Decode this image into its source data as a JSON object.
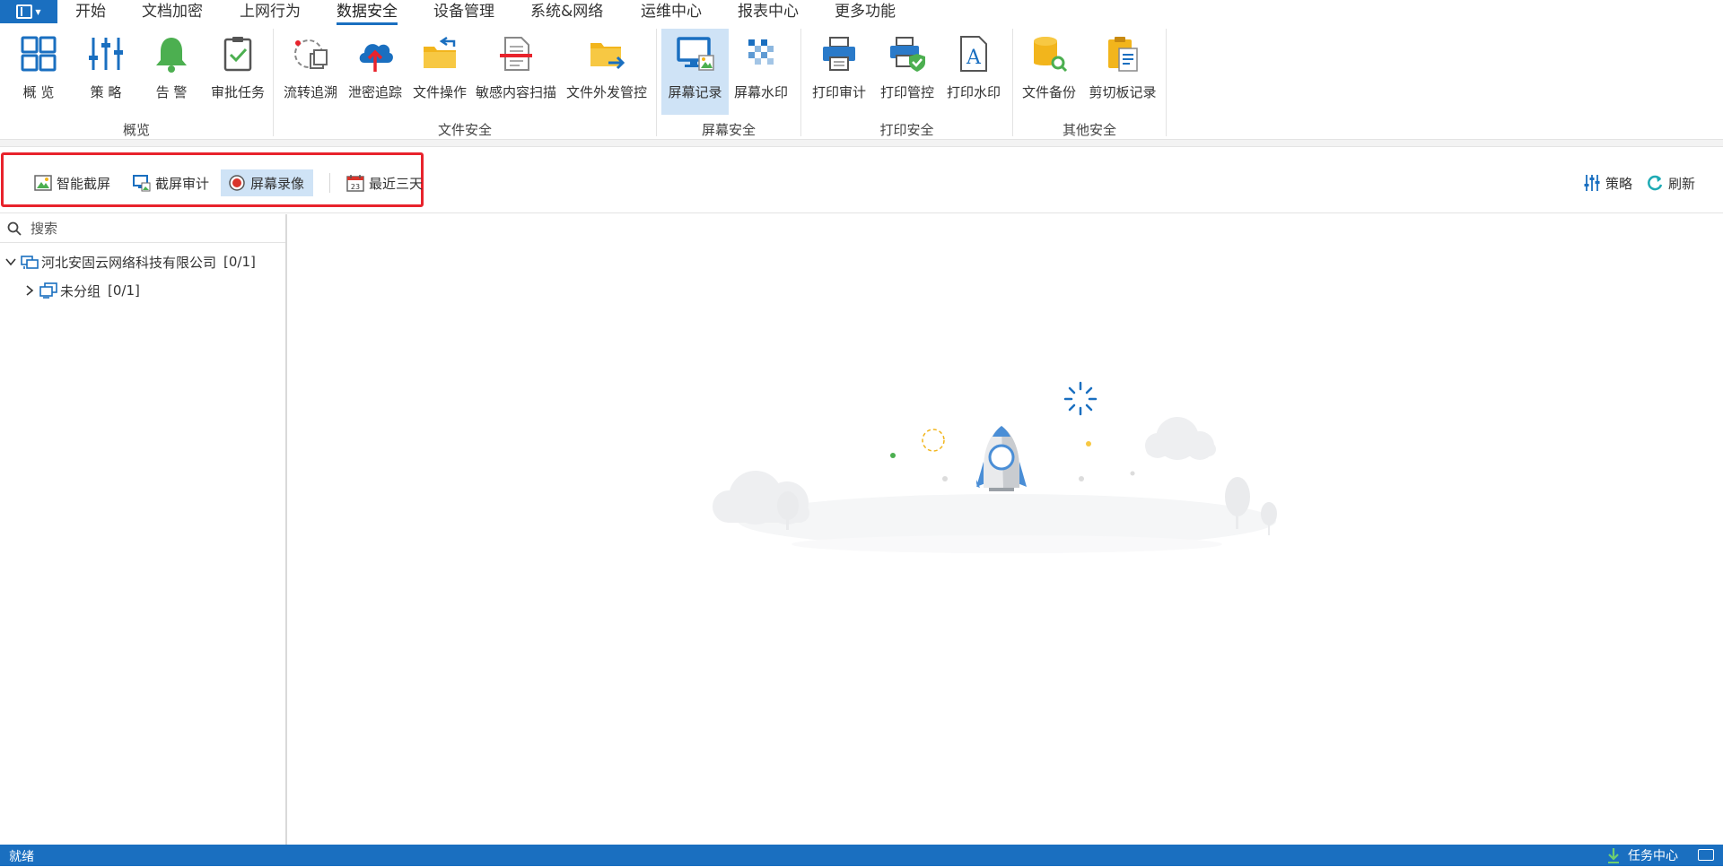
{
  "menu": {
    "tabs": [
      {
        "label": "开始"
      },
      {
        "label": "文档加密"
      },
      {
        "label": "上网行为"
      },
      {
        "label": "数据安全"
      },
      {
        "label": "设备管理"
      },
      {
        "label": "系统&网络"
      },
      {
        "label": "运维中心"
      },
      {
        "label": "报表中心"
      },
      {
        "label": "更多功能"
      }
    ],
    "active_tab": "数据安全"
  },
  "ribbon": {
    "groups": [
      {
        "label": "概览",
        "buttons": [
          {
            "label": "概 览",
            "icon": "overview-icon"
          },
          {
            "label": "策 略",
            "icon": "policy-icon"
          },
          {
            "label": "告 警",
            "icon": "bell-icon"
          },
          {
            "label": "审批任务",
            "icon": "approval-icon"
          }
        ]
      },
      {
        "label": "文件安全",
        "buttons": [
          {
            "label": "流转追溯",
            "icon": "trace-icon"
          },
          {
            "label": "泄密追踪",
            "icon": "cloud-upload-icon"
          },
          {
            "label": "文件操作",
            "icon": "folder-icon"
          },
          {
            "label": "敏感内容扫描",
            "icon": "scan-icon"
          },
          {
            "label": "文件外发管控",
            "icon": "folder-send-icon"
          }
        ]
      },
      {
        "label": "屏幕安全",
        "buttons": [
          {
            "label": "屏幕记录",
            "icon": "monitor-icon"
          },
          {
            "label": "屏幕水印",
            "icon": "watermark-icon"
          }
        ]
      },
      {
        "label": "打印安全",
        "buttons": [
          {
            "label": "打印审计",
            "icon": "printer-icon"
          },
          {
            "label": "打印管控",
            "icon": "printer-shield-icon"
          },
          {
            "label": "打印水印",
            "icon": "print-watermark-icon"
          }
        ]
      },
      {
        "label": "其他安全",
        "buttons": [
          {
            "label": "文件备份",
            "icon": "backup-icon"
          },
          {
            "label": "剪切板记录",
            "icon": "clipboard-icon"
          }
        ]
      }
    ],
    "active_button": "屏幕记录"
  },
  "toolbar": {
    "buttons": [
      {
        "label": "智能截屏",
        "icon": "picture-icon"
      },
      {
        "label": "截屏审计",
        "icon": "screen-audit-icon"
      },
      {
        "label": "屏幕录像",
        "icon": "record-icon"
      },
      {
        "label": "最近三天",
        "icon": "calendar-icon"
      }
    ],
    "active_button": "屏幕录像",
    "right": [
      {
        "label": "策略",
        "icon": "sliders-icon"
      },
      {
        "label": "刷新",
        "icon": "refresh-icon"
      }
    ],
    "highlight_color": "#e8232c"
  },
  "tree": {
    "search_placeholder": "搜索",
    "nodes": [
      {
        "label": "河北安固云网络科技有限公司",
        "count": "[0/1]",
        "expanded": true
      },
      {
        "label": "未分组",
        "count": "[0/1]",
        "expanded": false
      }
    ]
  },
  "status": {
    "text": "就绪",
    "task_center": "任务中心"
  },
  "colors": {
    "accent": "#1a6fc0",
    "selection": "#cfe3f6"
  }
}
